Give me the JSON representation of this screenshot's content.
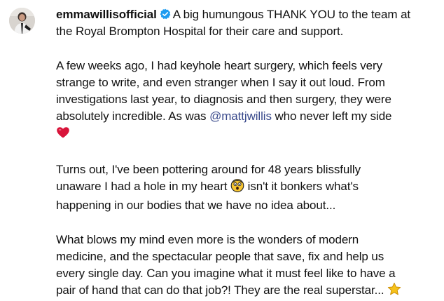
{
  "post": {
    "username": "emmawillisofficial",
    "icons": {
      "verified": "verified-badge-icon",
      "heart": "red-heart-emoji",
      "shocked": "astonished-face-emoji",
      "star": "star-emoji"
    },
    "colors": {
      "text": "#111111",
      "mention": "#3a4a8c",
      "verified": "#1d9bf0",
      "heart": "#d8143a",
      "star": "#f6c21a"
    },
    "caption": {
      "p1": {
        "l1": "A big humungous THANK YOU to the team at",
        "l2": "the Royal Brompton Hospital for their care and support."
      },
      "p2": {
        "l1": "A few weeks ago, I had keyhole heart surgery, which feels very",
        "l2": "strange to write, and even stranger when I say it out loud. From",
        "l3": "investigations last year, to diagnosis and then surgery, they were",
        "l4_before": "absolutely incredible. As was ",
        "mention": "@mattjwillis",
        "l4_after": " who never left my side"
      },
      "p3": {
        "l1": "Turns out, I've been pottering around for 48 years blissfully",
        "l2_before": "unaware I had a hole in my heart ",
        "l2_after": " isn't it bonkers what's",
        "l3": "happening in our bodies that we have no idea about..."
      },
      "p4": {
        "l1": "What blows my mind even more is the wonders of modern",
        "l2": "medicine, and the spectacular people that save, fix and help us",
        "l3": "every single day. Can you imagine what it must feel like to have a",
        "l4": "pair of hand that can do that job?! They are the real superstar... "
      }
    }
  }
}
